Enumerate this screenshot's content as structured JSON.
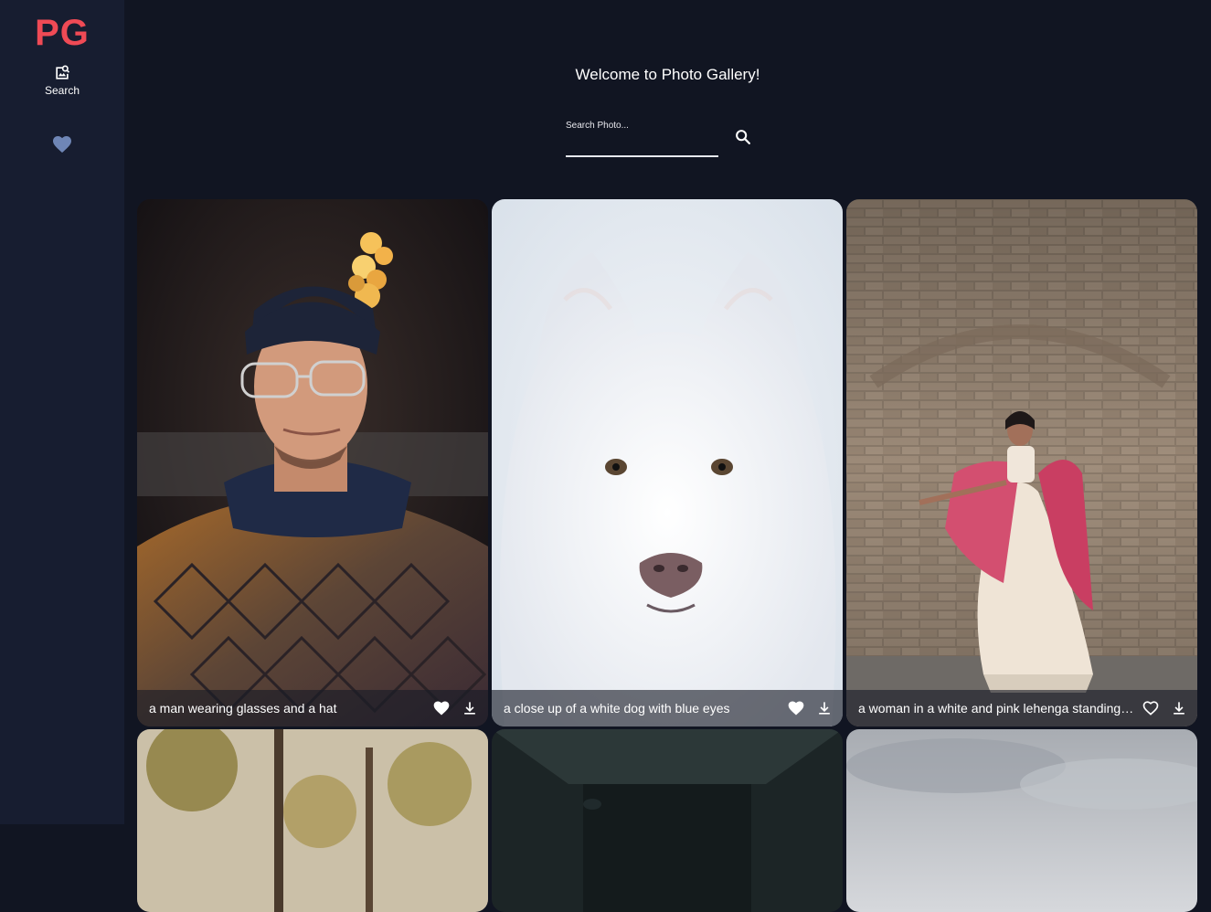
{
  "sidebar": {
    "logo": "PG",
    "search_label": "Search",
    "search_icon": "image-search-icon",
    "favorites_icon": "heart-icon"
  },
  "main": {
    "title": "Welcome to Photo Gallery!",
    "search_placeholder": "Search Photo...",
    "search_icon": "search-icon"
  },
  "photos": [
    {
      "caption": "a man wearing glasses and a hat",
      "liked": true,
      "image": "man-in-beanie-portrait"
    },
    {
      "caption": "a close up of a white dog with blue eyes",
      "liked": true,
      "image": "white-samoyed-dog"
    },
    {
      "caption": "a woman in a white and pink lehenga standing in front of a brick wall",
      "liked": false,
      "image": "woman-lehenga-brick-wall"
    },
    {
      "caption": "",
      "image": "autumn-trees"
    },
    {
      "caption": "",
      "image": "dark-corridor-ceiling"
    },
    {
      "caption": "",
      "image": "cloudy-sky"
    }
  ],
  "colors": {
    "background": "#111522",
    "sidebar": "#171d30",
    "logo": "#ef4a55",
    "favorites_icon": "#6f86b6"
  }
}
